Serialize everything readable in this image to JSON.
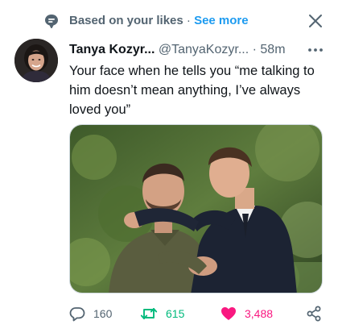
{
  "context": {
    "label": "Based on your likes",
    "separator": "·",
    "link": "See more"
  },
  "tweet": {
    "author": {
      "display_name": "Tanya Kozyr...",
      "handle": "@TanyaKozyr...",
      "separator": "·",
      "time": "58m"
    },
    "text": "Your face when he tells you “me talking to him doesn’t mean anything, I’ve always loved you”",
    "stats": {
      "replies": "160",
      "retweets": "615",
      "likes": "3,488"
    }
  },
  "icons": {
    "context": "speech-bubble-icon",
    "close": "close-icon",
    "more": "more-icon",
    "reply": "reply-icon",
    "retweet": "retweet-icon",
    "like": "heart-icon",
    "share": "share-icon"
  },
  "colors": {
    "accent": "#1d9bf0",
    "retweet": "#00ba7c",
    "like": "#f91880",
    "secondary_text": "#536471"
  }
}
